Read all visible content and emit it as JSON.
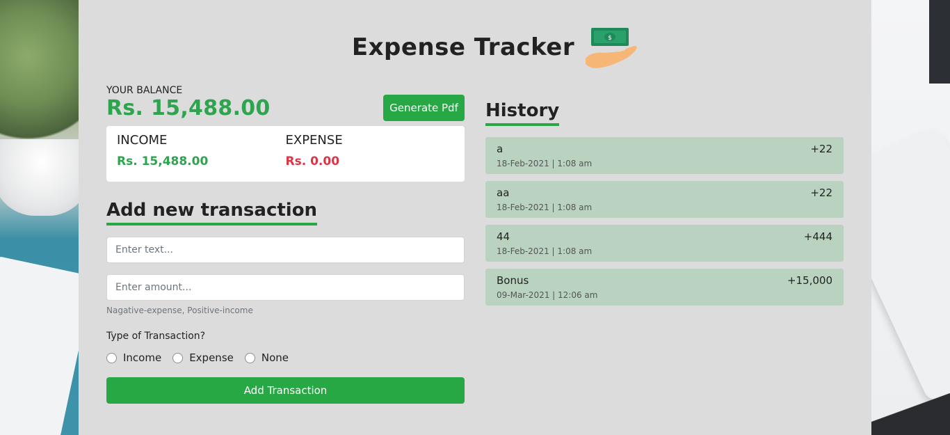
{
  "header": {
    "title": "Expense Tracker"
  },
  "balance": {
    "label": "YOUR BALANCE",
    "value": "Rs. 15,488.00"
  },
  "toolbar": {
    "generate_pdf": "Generate Pdf"
  },
  "summary": {
    "income_label": "INCOME",
    "income_value": "Rs. 15,488.00",
    "expense_label": "EXPENSE",
    "expense_value": "Rs. 0.00"
  },
  "form": {
    "title": "Add new transaction",
    "text_placeholder": "Enter text...",
    "amount_placeholder": "Enter amount...",
    "hint": "Nagative-expense, Positive-income",
    "type_label": "Type of Transaction?",
    "types": [
      {
        "label": "Income"
      },
      {
        "label": "Expense"
      },
      {
        "label": "None"
      }
    ],
    "submit": "Add Transaction"
  },
  "history": {
    "title": "History",
    "items": [
      {
        "text": "a",
        "amount": "+22",
        "date": "18-Feb-2021 | 1:08 am"
      },
      {
        "text": "aa",
        "amount": "+22",
        "date": "18-Feb-2021 | 1:08 am"
      },
      {
        "text": "44",
        "amount": "+444",
        "date": "18-Feb-2021 | 1:08 am"
      },
      {
        "text": "Bonus",
        "amount": "+15,000",
        "date": "09-Mar-2021 | 12:06 am"
      }
    ]
  },
  "colors": {
    "accent": "#28a745",
    "income": "#2ea44f",
    "expense": "#dc3545",
    "history_bg": "#b9d3c0"
  }
}
